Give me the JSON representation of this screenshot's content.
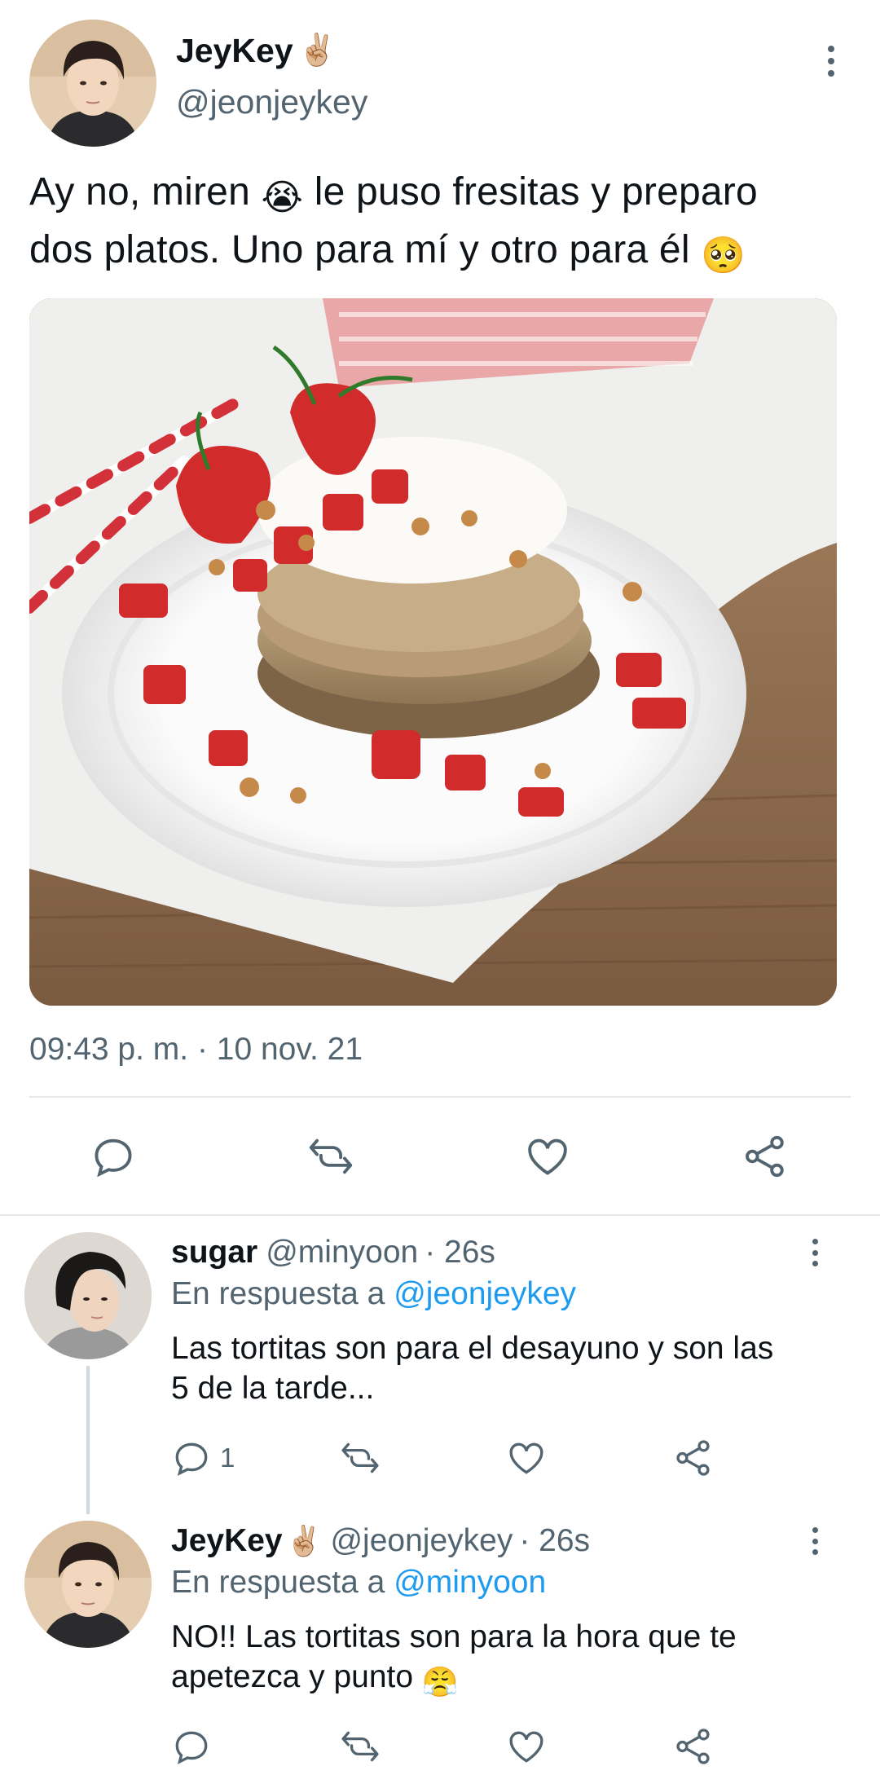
{
  "main_tweet": {
    "display_name": "JeyKey",
    "name_emoji": "✌🏼",
    "handle": "@jeonjeykey",
    "text_line1": "Ay no, miren",
    "text_emoji1": "😭",
    "text_line1b": "le puso fresitas y preparo",
    "text_line2": "dos platos. Uno para mí y otro para él",
    "text_emoji2": "🥺",
    "timestamp": "09:43 p. m. · 10 nov. 21",
    "actions": [
      "reply-icon",
      "retweet-icon",
      "like-icon",
      "share-icon"
    ]
  },
  "replies": [
    {
      "display_name": "sugar",
      "handle": "@minyoon",
      "time": "· 26s",
      "replying_prefix": "En respuesta a",
      "replying_to": "@jeonjeykey",
      "text_line1": "Las tortitas son para el desayuno y son las",
      "text_line2": "5 de la tarde...",
      "reply_count": "1"
    },
    {
      "display_name": "JeyKey",
      "name_emoji": "✌🏼",
      "handle": "@jeonjeykey",
      "time": "· 26s",
      "replying_prefix": "En respuesta a",
      "replying_to": "@minyoon",
      "text_line1": "NO!! Las tortitas son para la hora que te",
      "text_line2": "apetezca y punto",
      "text_emoji": "😤",
      "reply_count": ""
    }
  ],
  "colors": {
    "text": "#0f1419",
    "secondary": "#536471",
    "link": "#1d9bf0",
    "divider": "#e6e9ec"
  }
}
